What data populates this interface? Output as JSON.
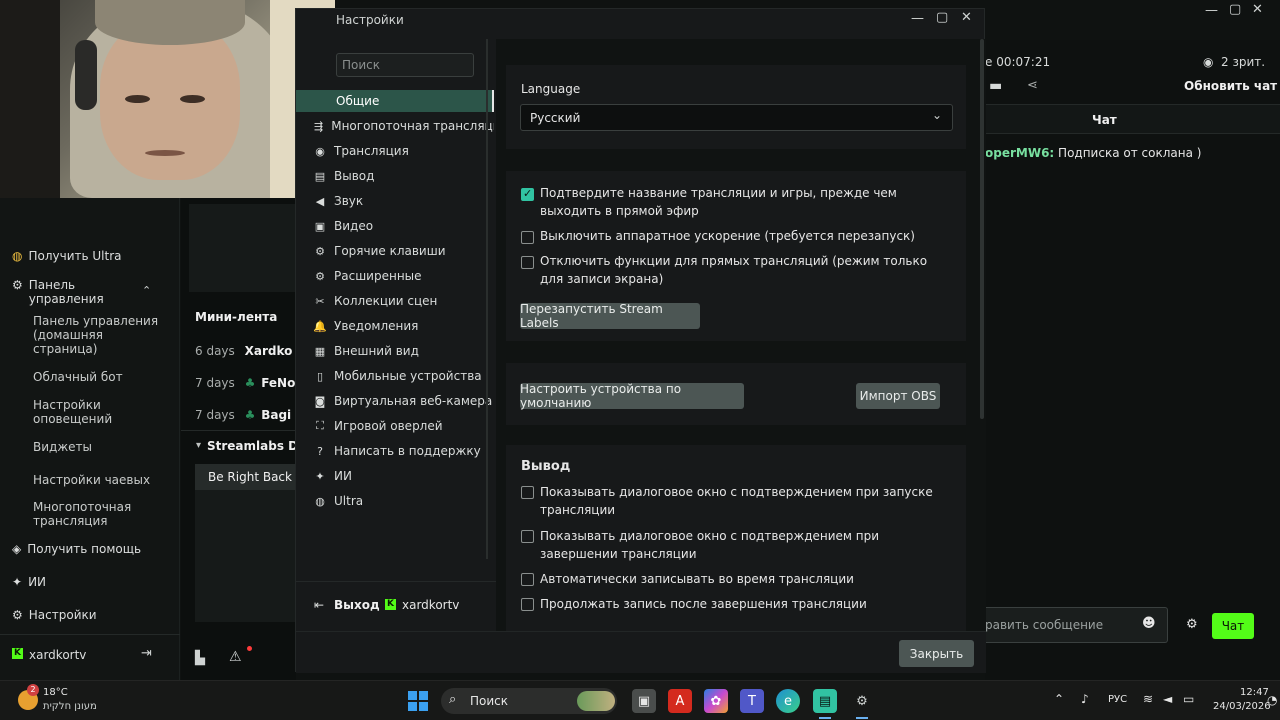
{
  "background_app": {
    "timer": "e 00:07:21",
    "viewers": "2 зрит.",
    "refresh_chat": "Обновить чат",
    "chat_title": "Чат",
    "chat_message_user": "operMW6:",
    "chat_message_text": "Подписка от соклана )",
    "chat_input_placeholder": "равить сообщение",
    "chat_send": "Чат",
    "mini_feed_title": "Мини-лента",
    "feed": [
      {
        "time": "6 days",
        "name": "Xardko"
      },
      {
        "time": "7 days",
        "name": "FeNo"
      },
      {
        "time": "7 days",
        "name": "Bagi"
      }
    ],
    "streamlabs_section": "Streamlabs Da",
    "be_right_back": "Be Right Back",
    "nav": {
      "get_ultra": "Получить Ultra",
      "dashboard": "Панель управления",
      "dashboard_home": "Панель управления (домашняя страница)",
      "cloudbot": "Облачный бот",
      "alert_settings": "Настройки оповещений",
      "widgets": "Виджеты",
      "tip_settings": "Настройки чаевых",
      "multistream": "Многопоточная трансляция",
      "get_help": "Получить помощь",
      "ai": "ИИ",
      "settings": "Настройки",
      "user": "xardkortv"
    }
  },
  "settings_dialog": {
    "title": "Настройки",
    "search_placeholder": "Поиск",
    "sidebar": [
      {
        "label": "Общие",
        "icon": "gear-icon"
      },
      {
        "label": "Многопоточная трансляци",
        "icon": "multistream-icon"
      },
      {
        "label": "Трансляция",
        "icon": "broadcast-icon"
      },
      {
        "label": "Вывод",
        "icon": "output-icon"
      },
      {
        "label": "Звук",
        "icon": "speaker-icon"
      },
      {
        "label": "Видео",
        "icon": "film-icon"
      },
      {
        "label": "Горячие клавиши",
        "icon": "gear-icon"
      },
      {
        "label": "Расширенные",
        "icon": "gears-icon"
      },
      {
        "label": "Коллекции сцен",
        "icon": "tools-icon"
      },
      {
        "label": "Уведомления",
        "icon": "bell-icon"
      },
      {
        "label": "Внешний вид",
        "icon": "grid-icon"
      },
      {
        "label": "Мобильные устройства",
        "icon": "mobile-icon"
      },
      {
        "label": "Виртуальная веб-камера",
        "icon": "camera-icon"
      },
      {
        "label": "Игровой оверлей",
        "icon": "overlay-icon"
      },
      {
        "label": "Написать в поддержку",
        "icon": "help-icon"
      },
      {
        "label": "ИИ",
        "icon": "sparkle-icon"
      },
      {
        "label": "Ultra",
        "icon": "ultra-icon"
      }
    ],
    "language_label": "Language",
    "language_value": "Русский",
    "options": [
      {
        "text": "Подтвердите название трансляции и игры, прежде чем выходить в прямой эфир",
        "checked": true
      },
      {
        "text": "Выключить аппаратное ускорение (требуется перезапуск)",
        "checked": false
      },
      {
        "text": "Отключить функции для прямых трансляций (режим только для записи экрана)",
        "checked": false
      }
    ],
    "restart_labels_button": "Перезапустить Stream Labels",
    "default_devices_button": "Настроить устройства по умолчанию",
    "import_obs_button": "Импорт OBS",
    "output_heading": "Вывод",
    "output_options": [
      {
        "text": "Показывать диалоговое окно с подтверждением при запуске трансляции",
        "checked": false
      },
      {
        "text": "Показывать диалоговое окно с подтверждением при завершении трансляции",
        "checked": false
      },
      {
        "text": "Автоматически записывать во время трансляции",
        "checked": false
      },
      {
        "text": "Продолжать запись после завершения трансляции",
        "checked": false
      }
    ],
    "logout": "Выход",
    "account": "xardkortv",
    "close_button": "Закрыть"
  },
  "taskbar": {
    "weather_temp": "18°C",
    "weather_text": "מעונן חלקית",
    "weather_badge": "2",
    "search_label": "Поиск",
    "language": "РУС",
    "time": "12:47",
    "date": "24/03/2026"
  },
  "colors": {
    "accent": "#31c3a2",
    "active_bg": "#2c5549",
    "chat_button": "#53fc18",
    "kick_green": "#53fc18"
  }
}
